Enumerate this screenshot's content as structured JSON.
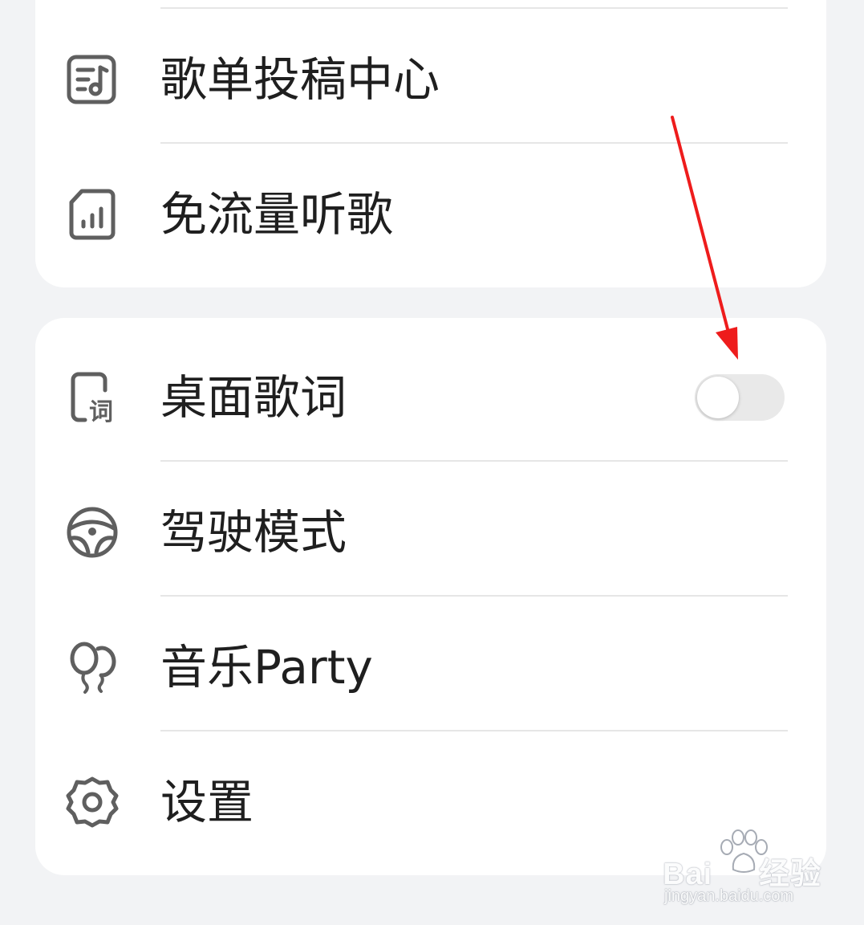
{
  "menu_top": {
    "items": [
      {
        "label": "歌单投稿中心",
        "icon": "playlist-submit-icon"
      },
      {
        "label": "免流量听歌",
        "icon": "data-free-sim-icon"
      }
    ]
  },
  "menu_bottom": {
    "items": [
      {
        "label": "桌面歌词",
        "icon": "desktop-lyrics-icon",
        "icon_text": "词",
        "toggle_on": false
      },
      {
        "label": "驾驶模式",
        "icon": "steering-wheel-icon"
      },
      {
        "label": "音乐Party",
        "icon": "balloons-icon"
      },
      {
        "label": "设置",
        "icon": "gear-icon"
      }
    ]
  },
  "annotation": {
    "color": "#ee1c1c",
    "shape": "arrow"
  },
  "watermark": {
    "brand_a": "Bai",
    "brand_b": "经验",
    "url": "jingyan.baidu.com"
  },
  "colors": {
    "background": "#f2f3f5",
    "card": "#ffffff",
    "icon_stroke": "#5f5f5f",
    "toggle_off": "#e9e9e9"
  }
}
